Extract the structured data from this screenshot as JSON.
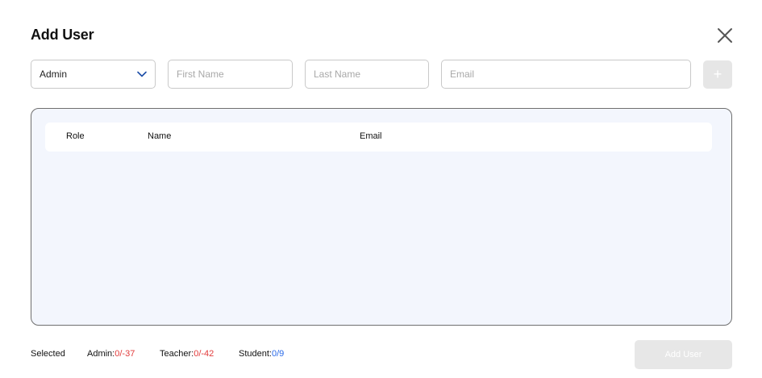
{
  "dialog": {
    "title": "Add User",
    "close_icon": "close-icon"
  },
  "form": {
    "role": {
      "value": "Admin",
      "icon": "chevron-down-icon"
    },
    "first_name": {
      "placeholder": "First Name",
      "value": ""
    },
    "last_name": {
      "placeholder": "Last Name",
      "value": ""
    },
    "email": {
      "placeholder": "Email",
      "value": ""
    },
    "add_button": {
      "label": "+"
    }
  },
  "table": {
    "columns": [
      "Role",
      "Name",
      "Email"
    ],
    "rows": []
  },
  "footer": {
    "selected_label": "Selected",
    "admin": {
      "label": "Admin:",
      "count": "0/-37"
    },
    "teacher": {
      "label": "Teacher:",
      "count": "0/-42"
    },
    "student": {
      "label": "Student:",
      "count": "0/9"
    },
    "submit_label": "Add User"
  },
  "colors": {
    "accent": "#1e4fa8",
    "over_limit": "#e23b3b",
    "within_limit": "#2a6ae8",
    "table_bg": "#f3f6fd",
    "disabled": "#e7e7e7"
  }
}
